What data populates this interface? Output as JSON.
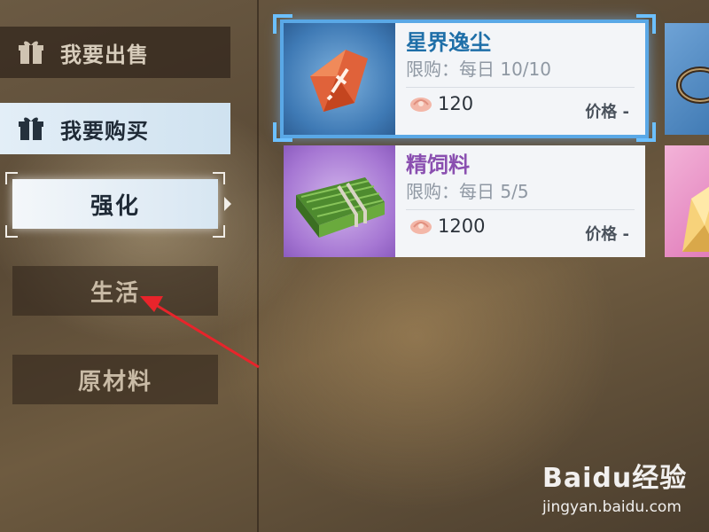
{
  "sidebar": {
    "sell_label": "我要出售",
    "buy_label": "我要购买",
    "categories": [
      {
        "label": "强化"
      },
      {
        "label": "生活"
      },
      {
        "label": "原材料"
      }
    ]
  },
  "items": [
    {
      "name": "星界逸尘",
      "limit": "限购：每日 10/10",
      "price": "120",
      "price_label": "价格 -",
      "name_color": "#1f6fa8"
    },
    {
      "name": "精饲料",
      "limit": "限购：每日 5/5",
      "price": "1200",
      "price_label": "价格 -",
      "name_color": "#8a4fb0"
    }
  ],
  "watermark": {
    "logo": "Baidu经验",
    "url": "jingyan.baidu.com"
  },
  "colors": {
    "selected_glow": "#5aa8e6",
    "annotation_arrow": "#e8242b"
  }
}
